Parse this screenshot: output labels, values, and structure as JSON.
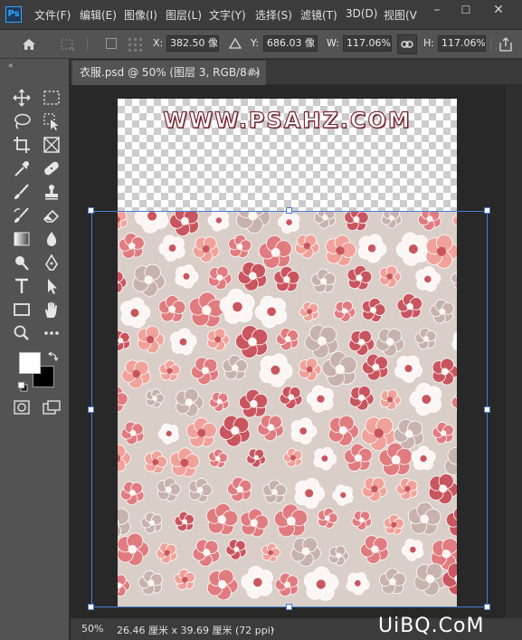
{
  "app": {
    "logo": "Ps"
  },
  "menu": [
    "文件(F)",
    "编辑(E)",
    "图像(I)",
    "图层(L)",
    "文字(Y)",
    "选择(S)",
    "滤镜(T)",
    "3D(D)",
    "视图(V"
  ],
  "window_controls": {
    "minimize": "–",
    "maximize": "☐",
    "close": "✕"
  },
  "options": {
    "x_label": "X:",
    "x_value": "382.50 像",
    "y_label": "Y:",
    "y_value": "686.03 像",
    "w_label": "W:",
    "w_value": "117.06%",
    "h_label": "H:",
    "h_value": "117.06%"
  },
  "tools_collapse": "«",
  "document": {
    "tab_title": "衣服.psd @ 50% (图层 3, RGB/8#) *",
    "tab_close": "×",
    "canvas_text": "WWW.PSAHZ.COM"
  },
  "status": {
    "zoom": "50%",
    "doc_size": "26.46 厘米 x 39.69 厘米 (72 ppi)",
    "arrow": "›"
  },
  "site_watermark": "UiBQ.CoM",
  "colors": {
    "pattern_bg": "#d9cec8",
    "flower_red": "#c9555f",
    "flower_pink": "#f0a29a",
    "flower_white": "#fbf6f3",
    "transform_box": "#4a7bd4"
  },
  "icons": [
    "home-icon",
    "marquee-options-icon",
    "checkbox-icon",
    "reference-point-icon",
    "delta-icon",
    "link-icon",
    "move-tool-icon",
    "rect-marquee-tool-icon",
    "lasso-tool-icon",
    "object-select-tool-icon",
    "crop-tool-icon",
    "frame-tool-icon",
    "eyedropper-tool-icon",
    "healing-brush-tool-icon",
    "brush-tool-icon",
    "stamp-tool-icon",
    "history-brush-tool-icon",
    "eraser-tool-icon",
    "gradient-tool-icon",
    "blur-tool-icon",
    "dodge-tool-icon",
    "pen-tool-icon",
    "type-tool-icon",
    "path-select-tool-icon",
    "rectangle-tool-icon",
    "hand-tool-icon",
    "zoom-tool-icon",
    "more-tools-icon",
    "foreground-color-swatch",
    "background-color-swatch",
    "swap-colors-icon",
    "default-colors-icon",
    "quick-mask-icon",
    "screen-mode-icon"
  ]
}
